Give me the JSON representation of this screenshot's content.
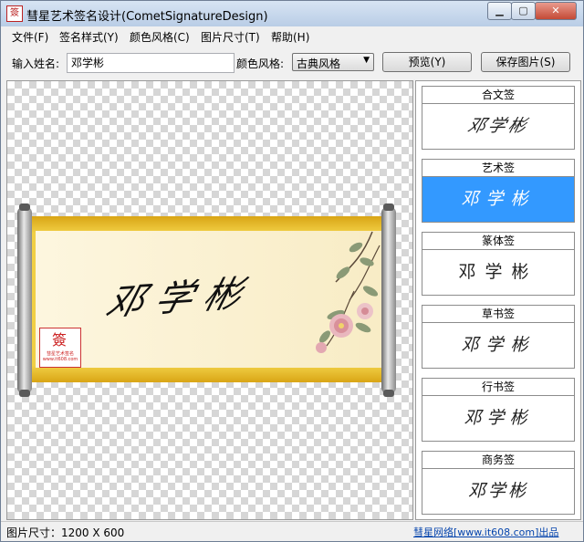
{
  "window": {
    "title": "彗星艺术签名设计(CometSignatureDesign)",
    "app_icon_glyph": "簽",
    "minimize_glyph": "▁",
    "maximize_glyph": "▢",
    "close_glyph": "✕"
  },
  "menu": {
    "items": [
      "文件(F)",
      "签名样式(Y)",
      "颜色风格(C)",
      "图片尺寸(T)",
      "帮助(H)"
    ]
  },
  "toolbar": {
    "name_label": "输入姓名:",
    "name_value": "邓学彬",
    "color_label": "颜色风格:",
    "color_selected": "古典风格",
    "dropdown_arrow": "▼",
    "preview_label": "预览(Y)",
    "save_label": "保存图片(S)"
  },
  "preview": {
    "signature": "邓学彬",
    "seal_mark": "簽",
    "seal_text": "彗星艺术签名 www.it608.com"
  },
  "styles": {
    "items": [
      {
        "title": "合文签",
        "sample": "邓学彬"
      },
      {
        "title": "艺术签",
        "sample": "邓学彬"
      },
      {
        "title": "篆体签",
        "sample": "邓学彬"
      },
      {
        "title": "草书签",
        "sample": "邓学彬"
      },
      {
        "title": "行书签",
        "sample": "邓学彬"
      },
      {
        "title": "商务签",
        "sample": "邓学彬"
      }
    ],
    "selected_index": 1
  },
  "status": {
    "size_text": "图片尺寸：1200 X 600",
    "link_text": "彗星网络[www.it608.com]出品"
  },
  "colors": {
    "selection": "#3399ff",
    "scroll_gold": "#f1cf45",
    "link": "#0645ad"
  }
}
